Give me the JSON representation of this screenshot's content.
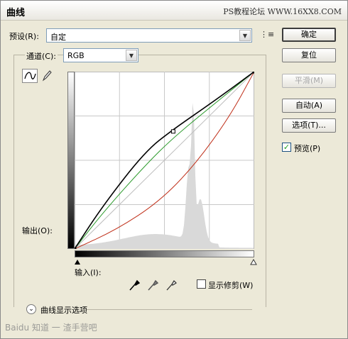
{
  "window": {
    "title": "曲线",
    "watermark": "PS教程论坛 WWW.16XX8.COM"
  },
  "preset": {
    "label": "预设(R):",
    "value": "自定"
  },
  "channel": {
    "label": "通道(C):",
    "value": "RGB"
  },
  "buttons": {
    "ok": "确定",
    "reset": "复位",
    "smooth": "平滑(M)",
    "auto": "自动(A)",
    "options": "选项(T)..."
  },
  "preview": {
    "label": "预览(P)",
    "checked": true
  },
  "axis": {
    "output": "输出(O):",
    "input": "输入(I):"
  },
  "clipping": {
    "label": "显示修剪(W)",
    "checked": false
  },
  "display_options": {
    "label": "曲线显示选项"
  },
  "credit": "Baidu 知道 一 渣手营吧",
  "colors": {
    "rgb_curve": "#000000",
    "green_curve": "#2a9a2a",
    "red_curve": "#c0301a",
    "grid": "#c8c8c8"
  },
  "chart_data": {
    "type": "line",
    "xlim": [
      0,
      255
    ],
    "ylim": [
      0,
      255
    ],
    "series": [
      {
        "name": "RGB",
        "points": [
          [
            0,
            0
          ],
          [
            40,
            62
          ],
          [
            100,
            140
          ],
          [
            140,
            172
          ],
          [
            200,
            214
          ],
          [
            255,
            255
          ]
        ]
      },
      {
        "name": "Green",
        "points": [
          [
            0,
            0
          ],
          [
            40,
            52
          ],
          [
            100,
            120
          ],
          [
            140,
            160
          ],
          [
            200,
            210
          ],
          [
            255,
            255
          ]
        ]
      },
      {
        "name": "Red",
        "points": [
          [
            0,
            0
          ],
          [
            60,
            28
          ],
          [
            120,
            68
          ],
          [
            170,
            120
          ],
          [
            220,
            190
          ],
          [
            255,
            255
          ]
        ]
      }
    ],
    "control_point": [
      140,
      169
    ]
  }
}
